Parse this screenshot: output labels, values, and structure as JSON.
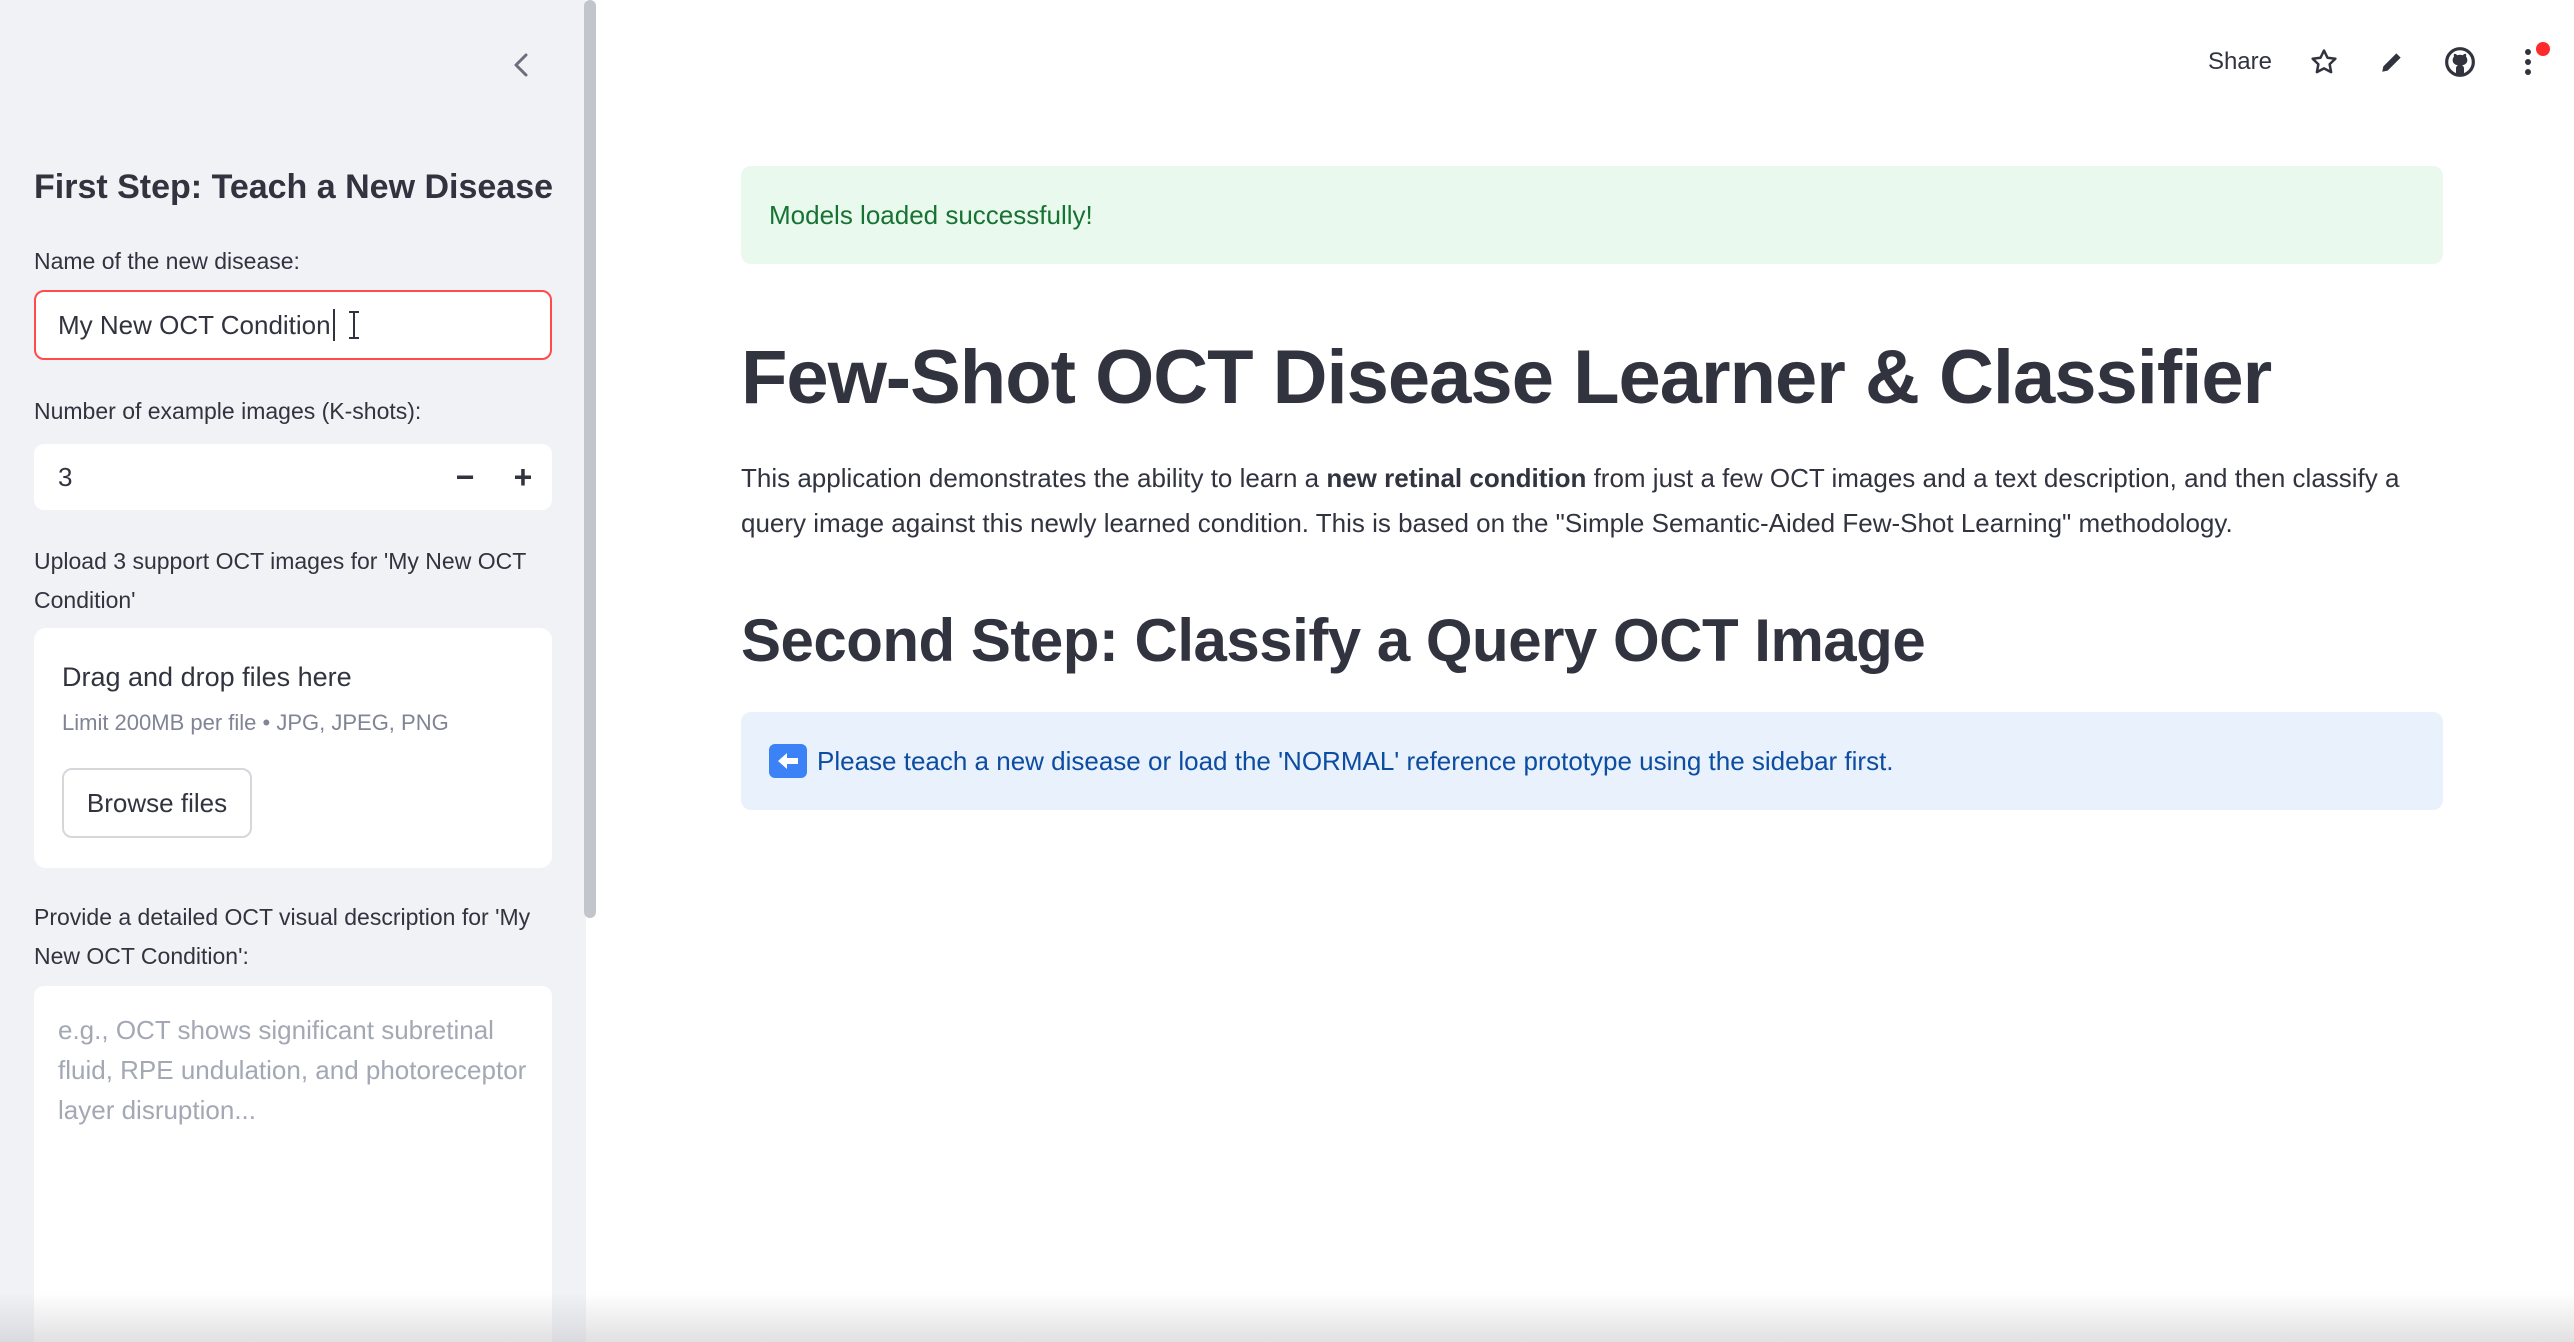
{
  "sidebar": {
    "heading": "First Step: Teach a New Disease",
    "disease_name_label": "Name of the new disease:",
    "disease_name_value": "My New OCT Condition",
    "kshots_label": "Number of example images (K-shots):",
    "kshots_value": "3",
    "kshots_decrement": "−",
    "kshots_increment": "+",
    "upload_label": "Upload 3 support OCT images for 'My New OCT Condition'",
    "uploader_title": "Drag and drop files here",
    "uploader_limit": "Limit 200MB per file • JPG, JPEG, PNG",
    "browse_label": "Browse files",
    "description_label": "Provide a detailed OCT visual description for 'My New OCT Condition':",
    "description_placeholder": "e.g., OCT shows significant subretinal fluid, RPE undulation, and photoreceptor layer disruption..."
  },
  "toolbar": {
    "share_label": "Share"
  },
  "main": {
    "success_message": "Models loaded successfully!",
    "title": "Few-Shot OCT Disease Learner & Classifier",
    "intro_part1": "This application demonstrates the ability to learn a ",
    "intro_bold": "new retinal condition",
    "intro_part2": " from just a few OCT images and a text description, and then classify a query image against this newly learned condition. This is based on the \"Simple Semantic-Aided Few-Shot Learning\" methodology.",
    "section_title": "Second Step: Classify a Query OCT Image",
    "info_message": "Please teach a new disease or load the 'NORMAL' reference prototype using the sidebar first."
  },
  "colors": {
    "accent": "#ff4b4b",
    "success_bg": "#e9f9ee",
    "success_text": "#177233",
    "info_bg": "#e8f1fc",
    "info_text": "#0c4da2",
    "sidebar_bg": "#f0f2f6"
  }
}
